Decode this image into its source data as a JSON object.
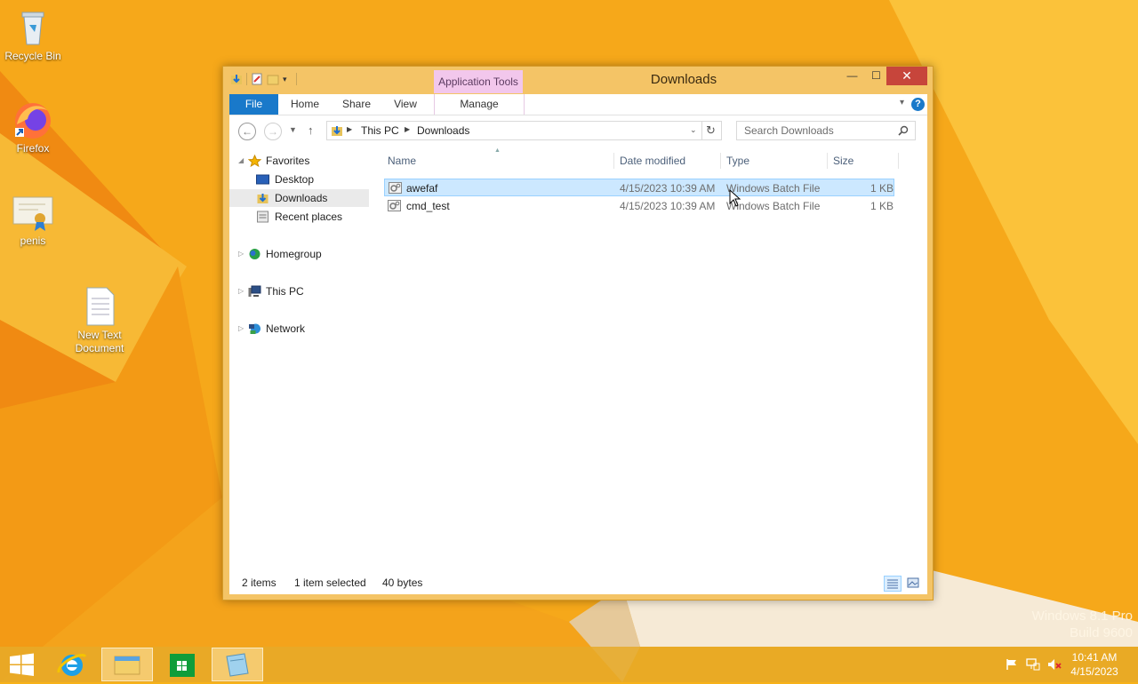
{
  "desktop": {
    "icons": [
      {
        "label": "Recycle Bin",
        "icon": "recycle-bin-icon"
      },
      {
        "label": "Firefox",
        "icon": "firefox-icon"
      },
      {
        "label": "penis",
        "icon": "certificate-icon"
      },
      {
        "label": "New Text Document",
        "icon": "text-document-icon"
      }
    ],
    "watermark": {
      "line1": "Windows 8.1 Pro",
      "line2": "Build 9600"
    }
  },
  "window": {
    "title": "Downloads",
    "context_tab": "Application Tools",
    "controls": {
      "minimize": "—",
      "maximize": "☐",
      "close": "✕"
    },
    "ribbon_tabs": [
      "File",
      "Home",
      "Share",
      "View",
      "Manage"
    ],
    "help": "?",
    "address": {
      "crumbs": [
        "This PC",
        "Downloads"
      ]
    },
    "search_placeholder": "Search Downloads",
    "nav_pane": {
      "favorites": {
        "label": "Favorites",
        "items": [
          "Desktop",
          "Downloads",
          "Recent places"
        ],
        "selected": "Downloads"
      },
      "homegroup": "Homegroup",
      "this_pc": "This PC",
      "network": "Network"
    },
    "file_list": {
      "columns": [
        "Name",
        "Date modified",
        "Type",
        "Size"
      ],
      "rows": [
        {
          "name": "awefaf",
          "date": "4/15/2023 10:39 AM",
          "type": "Windows Batch File",
          "size": "1 KB",
          "selected": true
        },
        {
          "name": "cmd_test",
          "date": "4/15/2023 10:39 AM",
          "type": "Windows Batch File",
          "size": "1 KB",
          "selected": false
        }
      ]
    },
    "status": {
      "count": "2 items",
      "selection": "1 item selected",
      "bytes": "40 bytes"
    }
  },
  "taskbar": {
    "apps": [
      "start-icon",
      "internet-explorer-icon",
      "file-explorer-icon",
      "store-icon",
      "notepad-icon"
    ],
    "active_app": "file-explorer-icon",
    "clock": {
      "time": "10:41 AM",
      "date": "4/15/2023"
    }
  }
}
